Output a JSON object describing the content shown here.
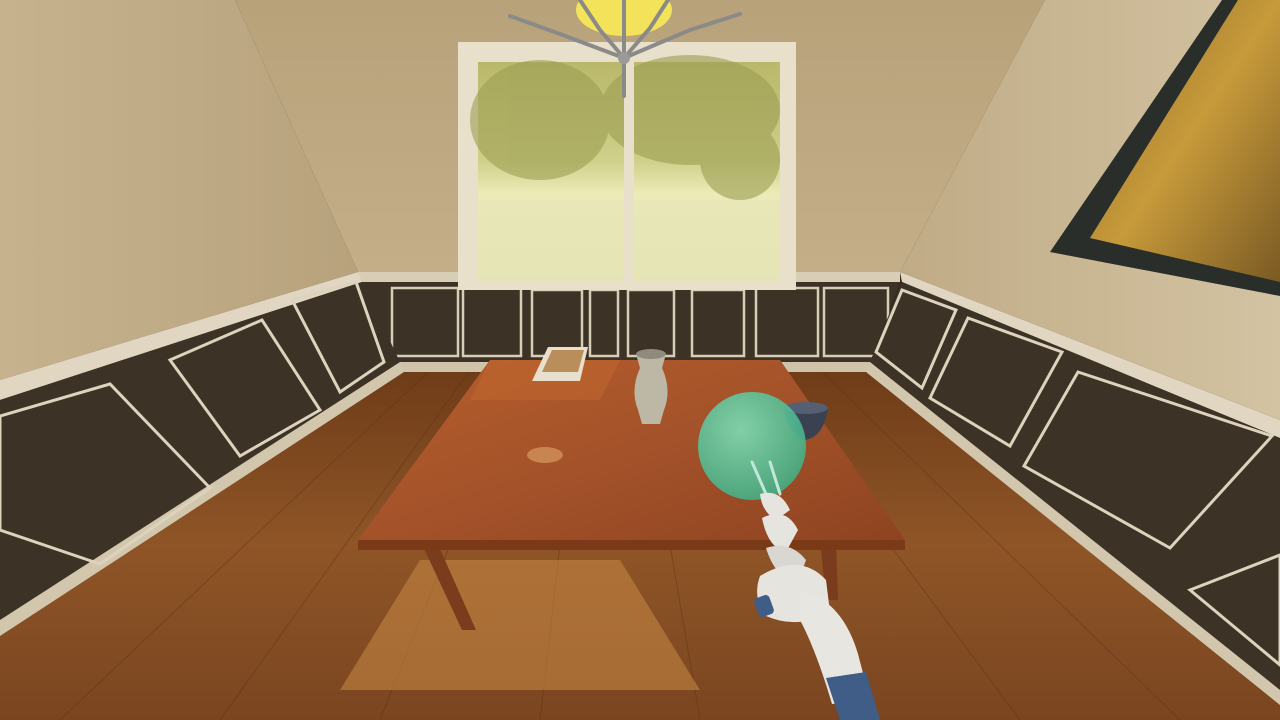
{
  "scene": {
    "description_label": "",
    "objects": [
      {
        "id": "window",
        "icon": "window-icon"
      },
      {
        "id": "chandelier",
        "icon": "chandelier-icon"
      },
      {
        "id": "dining-table",
        "icon": "table-icon"
      },
      {
        "id": "vase",
        "icon": "vase-icon"
      },
      {
        "id": "magazine",
        "icon": "book-icon"
      },
      {
        "id": "bowl",
        "icon": "bowl-icon"
      },
      {
        "id": "grasp-target-sphere",
        "icon": "sphere-marker-icon"
      },
      {
        "id": "robot-arm",
        "icon": "robot-arm-icon"
      },
      {
        "id": "wall-painting",
        "icon": "painting-icon"
      }
    ]
  },
  "colors": {
    "wall_upper": "#c9b591",
    "wainscot": "#3c3226",
    "wainscot_trim": "#ddd3bd",
    "floor": "#8a4f22",
    "table_top": "#a4522a",
    "window_light": "#e8e4a8",
    "target_sphere": "#4fc79a",
    "arm_white": "#e6e4df",
    "arm_blue": "#3f5d86"
  }
}
